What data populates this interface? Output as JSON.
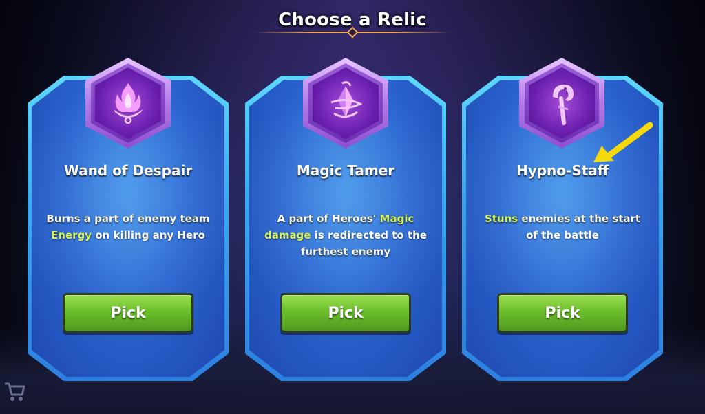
{
  "header": {
    "title": "Choose a Relic"
  },
  "relics": [
    {
      "name": "Wand of Despair",
      "icon": "flame-chalice-icon",
      "description_parts": [
        {
          "text": "Burns a part of enemy team ",
          "highlight": false
        },
        {
          "text": "Energy",
          "highlight": true
        },
        {
          "text": " on killing any Hero",
          "highlight": false
        }
      ],
      "button_label": "Pick"
    },
    {
      "name": "Magic Tamer",
      "icon": "crystal-swirl-icon",
      "description_parts": [
        {
          "text": "A part of Heroes' ",
          "highlight": false
        },
        {
          "text": "Magic damage",
          "highlight": true
        },
        {
          "text": " is redirected to the furthest enemy",
          "highlight": false
        }
      ],
      "button_label": "Pick"
    },
    {
      "name": "Hypno-Staff",
      "icon": "snake-staff-icon",
      "description_parts": [
        {
          "text": "Stuns",
          "highlight": true
        },
        {
          "text": " enemies at the start of the battle",
          "highlight": false
        }
      ],
      "button_label": "Pick"
    }
  ],
  "colors": {
    "highlight_text": "#d6f25a",
    "button_green": "#6cbf2c",
    "card_blue": "#2a64cf",
    "badge_purple": "#6a1fae",
    "arrow_yellow": "#f5d90a",
    "title_accent": "#f2a95c"
  },
  "overlay": {
    "annotation": "yellow-arrow-pointing-at-hypno-staff"
  }
}
